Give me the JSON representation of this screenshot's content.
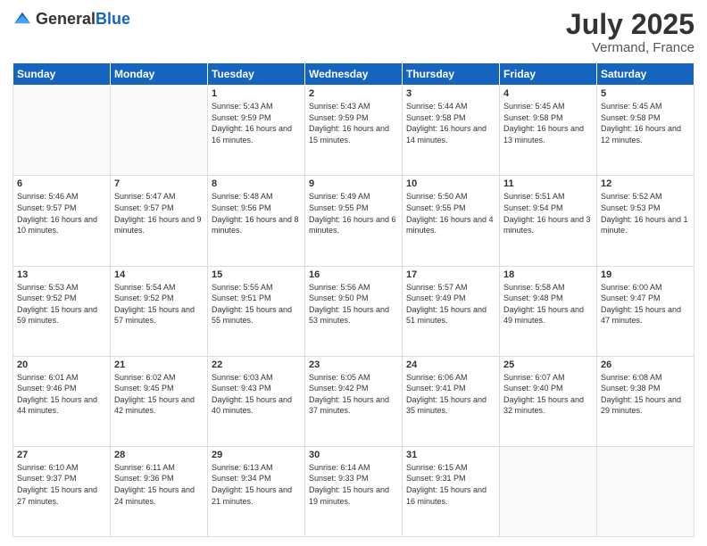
{
  "header": {
    "logo_general": "General",
    "logo_blue": "Blue",
    "month": "July 2025",
    "location": "Vermand, France"
  },
  "days_of_week": [
    "Sunday",
    "Monday",
    "Tuesday",
    "Wednesday",
    "Thursday",
    "Friday",
    "Saturday"
  ],
  "weeks": [
    [
      {
        "day": "",
        "info": ""
      },
      {
        "day": "",
        "info": ""
      },
      {
        "day": "1",
        "info": "Sunrise: 5:43 AM\nSunset: 9:59 PM\nDaylight: 16 hours and 16 minutes."
      },
      {
        "day": "2",
        "info": "Sunrise: 5:43 AM\nSunset: 9:59 PM\nDaylight: 16 hours and 15 minutes."
      },
      {
        "day": "3",
        "info": "Sunrise: 5:44 AM\nSunset: 9:58 PM\nDaylight: 16 hours and 14 minutes."
      },
      {
        "day": "4",
        "info": "Sunrise: 5:45 AM\nSunset: 9:58 PM\nDaylight: 16 hours and 13 minutes."
      },
      {
        "day": "5",
        "info": "Sunrise: 5:45 AM\nSunset: 9:58 PM\nDaylight: 16 hours and 12 minutes."
      }
    ],
    [
      {
        "day": "6",
        "info": "Sunrise: 5:46 AM\nSunset: 9:57 PM\nDaylight: 16 hours and 10 minutes."
      },
      {
        "day": "7",
        "info": "Sunrise: 5:47 AM\nSunset: 9:57 PM\nDaylight: 16 hours and 9 minutes."
      },
      {
        "day": "8",
        "info": "Sunrise: 5:48 AM\nSunset: 9:56 PM\nDaylight: 16 hours and 8 minutes."
      },
      {
        "day": "9",
        "info": "Sunrise: 5:49 AM\nSunset: 9:55 PM\nDaylight: 16 hours and 6 minutes."
      },
      {
        "day": "10",
        "info": "Sunrise: 5:50 AM\nSunset: 9:55 PM\nDaylight: 16 hours and 4 minutes."
      },
      {
        "day": "11",
        "info": "Sunrise: 5:51 AM\nSunset: 9:54 PM\nDaylight: 16 hours and 3 minutes."
      },
      {
        "day": "12",
        "info": "Sunrise: 5:52 AM\nSunset: 9:53 PM\nDaylight: 16 hours and 1 minute."
      }
    ],
    [
      {
        "day": "13",
        "info": "Sunrise: 5:53 AM\nSunset: 9:52 PM\nDaylight: 15 hours and 59 minutes."
      },
      {
        "day": "14",
        "info": "Sunrise: 5:54 AM\nSunset: 9:52 PM\nDaylight: 15 hours and 57 minutes."
      },
      {
        "day": "15",
        "info": "Sunrise: 5:55 AM\nSunset: 9:51 PM\nDaylight: 15 hours and 55 minutes."
      },
      {
        "day": "16",
        "info": "Sunrise: 5:56 AM\nSunset: 9:50 PM\nDaylight: 15 hours and 53 minutes."
      },
      {
        "day": "17",
        "info": "Sunrise: 5:57 AM\nSunset: 9:49 PM\nDaylight: 15 hours and 51 minutes."
      },
      {
        "day": "18",
        "info": "Sunrise: 5:58 AM\nSunset: 9:48 PM\nDaylight: 15 hours and 49 minutes."
      },
      {
        "day": "19",
        "info": "Sunrise: 6:00 AM\nSunset: 9:47 PM\nDaylight: 15 hours and 47 minutes."
      }
    ],
    [
      {
        "day": "20",
        "info": "Sunrise: 6:01 AM\nSunset: 9:46 PM\nDaylight: 15 hours and 44 minutes."
      },
      {
        "day": "21",
        "info": "Sunrise: 6:02 AM\nSunset: 9:45 PM\nDaylight: 15 hours and 42 minutes."
      },
      {
        "day": "22",
        "info": "Sunrise: 6:03 AM\nSunset: 9:43 PM\nDaylight: 15 hours and 40 minutes."
      },
      {
        "day": "23",
        "info": "Sunrise: 6:05 AM\nSunset: 9:42 PM\nDaylight: 15 hours and 37 minutes."
      },
      {
        "day": "24",
        "info": "Sunrise: 6:06 AM\nSunset: 9:41 PM\nDaylight: 15 hours and 35 minutes."
      },
      {
        "day": "25",
        "info": "Sunrise: 6:07 AM\nSunset: 9:40 PM\nDaylight: 15 hours and 32 minutes."
      },
      {
        "day": "26",
        "info": "Sunrise: 6:08 AM\nSunset: 9:38 PM\nDaylight: 15 hours and 29 minutes."
      }
    ],
    [
      {
        "day": "27",
        "info": "Sunrise: 6:10 AM\nSunset: 9:37 PM\nDaylight: 15 hours and 27 minutes."
      },
      {
        "day": "28",
        "info": "Sunrise: 6:11 AM\nSunset: 9:36 PM\nDaylight: 15 hours and 24 minutes."
      },
      {
        "day": "29",
        "info": "Sunrise: 6:13 AM\nSunset: 9:34 PM\nDaylight: 15 hours and 21 minutes."
      },
      {
        "day": "30",
        "info": "Sunrise: 6:14 AM\nSunset: 9:33 PM\nDaylight: 15 hours and 19 minutes."
      },
      {
        "day": "31",
        "info": "Sunrise: 6:15 AM\nSunset: 9:31 PM\nDaylight: 15 hours and 16 minutes."
      },
      {
        "day": "",
        "info": ""
      },
      {
        "day": "",
        "info": ""
      }
    ]
  ]
}
